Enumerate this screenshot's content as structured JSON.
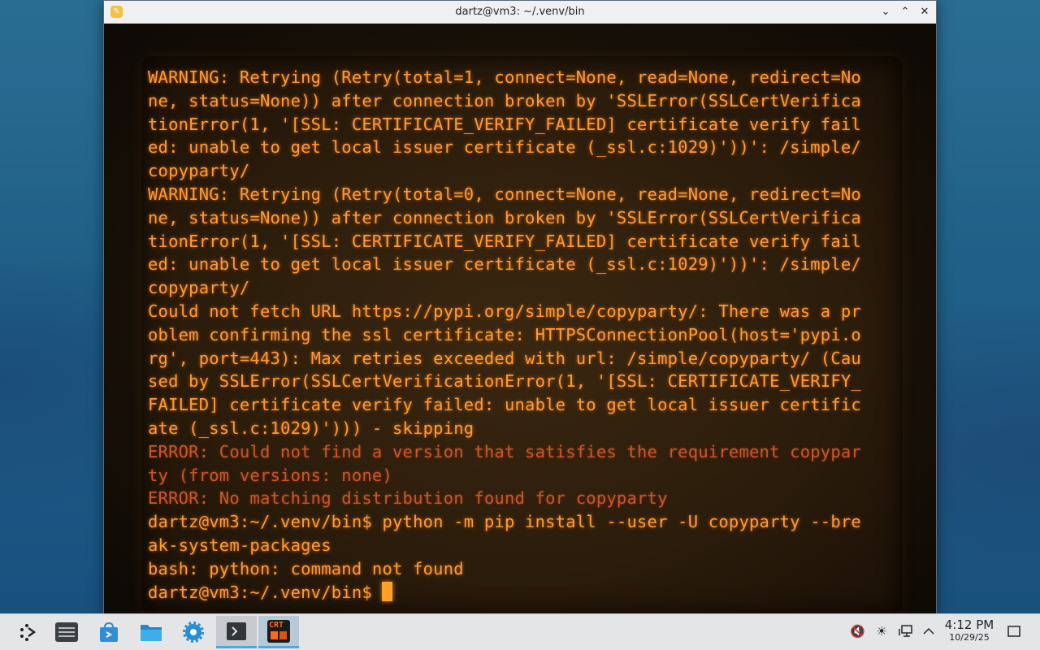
{
  "window": {
    "title": "dartz@vm3: ~/.venv/bin",
    "icon": "terminal-app-icon",
    "controls": [
      "minimize",
      "maximize",
      "close"
    ]
  },
  "terminal": {
    "lines": [
      {
        "text": "WARNING: Retrying (Retry(total=1, connect=None, read=None, redirect=No",
        "type": "normal"
      },
      {
        "text": "ne, status=None)) after connection broken by 'SSLError(SSLCertVerifica",
        "type": "normal"
      },
      {
        "text": "tionError(1, '[SSL: CERTIFICATE_VERIFY_FAILED] certificate verify fail",
        "type": "normal"
      },
      {
        "text": "ed: unable to get local issuer certificate (_ssl.c:1029)'))': /simple/",
        "type": "normal"
      },
      {
        "text": "copyparty/",
        "type": "normal"
      },
      {
        "text": "WARNING: Retrying (Retry(total=0, connect=None, read=None, redirect=No",
        "type": "normal"
      },
      {
        "text": "ne, status=None)) after connection broken by 'SSLError(SSLCertVerifica",
        "type": "normal"
      },
      {
        "text": "tionError(1, '[SSL: CERTIFICATE_VERIFY_FAILED] certificate verify fail",
        "type": "normal"
      },
      {
        "text": "ed: unable to get local issuer certificate (_ssl.c:1029)'))': /simple/",
        "type": "normal"
      },
      {
        "text": "copyparty/",
        "type": "normal"
      },
      {
        "text": "Could not fetch URL https://pypi.org/simple/copyparty/: There was a pr",
        "type": "normal"
      },
      {
        "text": "oblem confirming the ssl certificate: HTTPSConnectionPool(host='pypi.o",
        "type": "normal"
      },
      {
        "text": "rg', port=443): Max retries exceeded with url: /simple/copyparty/ (Cau",
        "type": "normal"
      },
      {
        "text": "sed by SSLError(SSLCertVerificationError(1, '[SSL: CERTIFICATE_VERIFY_",
        "type": "normal"
      },
      {
        "text": "FAILED] certificate verify failed: unable to get local issuer certific",
        "type": "normal"
      },
      {
        "text": "ate (_ssl.c:1029)'))) - skipping",
        "type": "normal"
      },
      {
        "text": "ERROR: Could not find a version that satisfies the requirement copypar",
        "type": "err"
      },
      {
        "text": "ty (from versions: none)",
        "type": "err"
      },
      {
        "text": "ERROR: No matching distribution found for copyparty",
        "type": "err"
      },
      {
        "text": "dartz@vm3:~/.venv/bin$ python -m pip install --user -U copyparty --bre",
        "type": "normal"
      },
      {
        "text": "ak-system-packages",
        "type": "normal"
      },
      {
        "text": "bash: python: command not found",
        "type": "normal"
      }
    ],
    "prompt": "dartz@vm3:~/.venv/bin$ "
  },
  "taskbar": {
    "items": [
      {
        "name": "application-launcher-icon",
        "label": "Application Launcher"
      },
      {
        "name": "pager-icon",
        "label": "Pager"
      },
      {
        "name": "discover-icon",
        "label": "Discover"
      },
      {
        "name": "file-manager-icon",
        "label": "Dolphin"
      },
      {
        "name": "system-settings-icon",
        "label": "System Settings"
      },
      {
        "name": "terminal-icon",
        "label": "Konsole"
      },
      {
        "name": "cool-retro-term-icon",
        "label": "CRT"
      }
    ],
    "crt_label": "CRT",
    "tray": [
      "volume-muted-icon",
      "brightness-icon",
      "network-icon",
      "show-hidden-icon"
    ],
    "time": "4:12 PM",
    "date": "10/29/25"
  },
  "colors": {
    "terminal_text": "#ff9a35",
    "terminal_error": "#c9552a",
    "accent": "#3daee9"
  }
}
